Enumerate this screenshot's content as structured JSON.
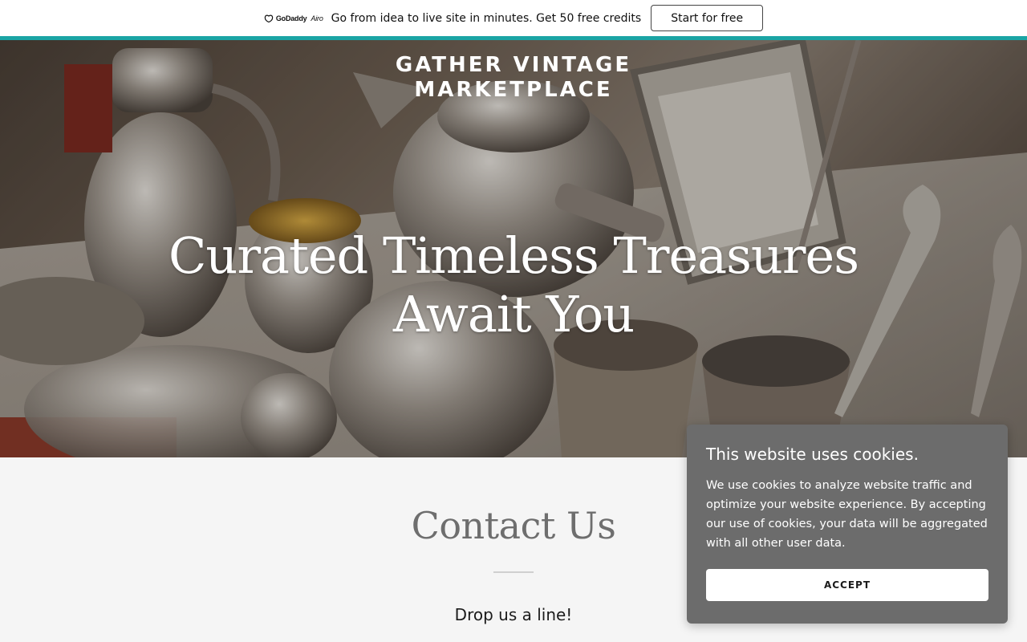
{
  "promo": {
    "logo_brand": "GoDaddy",
    "logo_product": "Airo",
    "text": "Go from idea to live site in minutes. Get 50 free credits",
    "button_label": "Start for free",
    "accent_color": "#1ba4a4"
  },
  "hero": {
    "site_title_line1": "GATHER VINTAGE",
    "site_title_line2": "MARKETPLACE",
    "headline_line1": "Curated Timeless Treasures",
    "headline_line2": "Await You",
    "image_subject": "antique silver teapots, cups and spoons"
  },
  "contact": {
    "title": "Contact Us",
    "subtitle": "Drop us a line!"
  },
  "cookie": {
    "title": "This website uses cookies.",
    "body": "We use cookies to analyze website traffic and optimize your website experience. By accepting our use of cookies, your data will be aggregated with all other user data.",
    "accept_label": "ACCEPT"
  }
}
